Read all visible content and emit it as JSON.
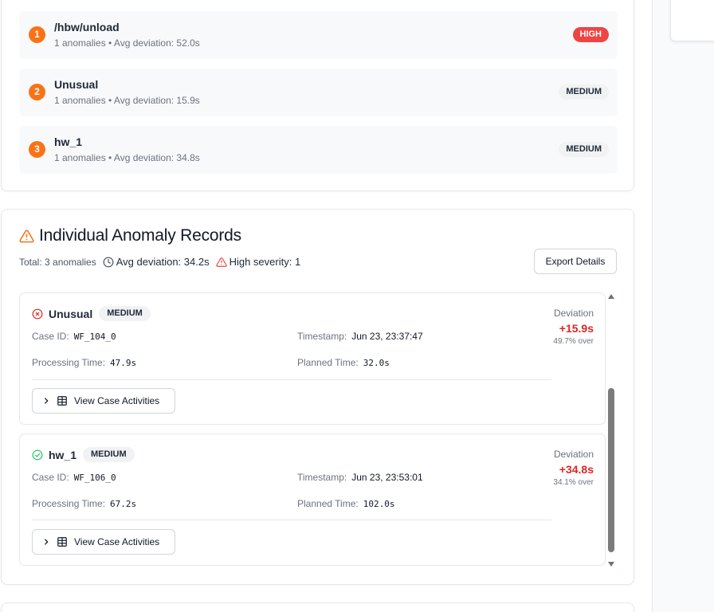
{
  "summary": {
    "items": [
      {
        "rank": "1",
        "title": "/hbw/unload",
        "subtitle": "1 anomalies • Avg deviation: 52.0s",
        "severity": "HIGH"
      },
      {
        "rank": "2",
        "title": "Unusual",
        "subtitle": "1 anomalies • Avg deviation: 15.9s",
        "severity": "MEDIUM"
      },
      {
        "rank": "3",
        "title": "hw_1",
        "subtitle": "1 anomalies • Avg deviation: 34.8s",
        "severity": "MEDIUM"
      }
    ]
  },
  "records": {
    "title": "Individual Anomaly Records",
    "total": "Total: 3 anomalies",
    "avg_deviation": "Avg deviation: 34.2s",
    "high_severity": "High severity: 1",
    "export_label": "Export Details",
    "labels": {
      "case_id": "Case ID:",
      "timestamp": "Timestamp:",
      "processing_time": "Processing Time:",
      "planned_time": "Planned Time:",
      "deviation": "Deviation",
      "view_activities": "View Case Activities"
    },
    "items": [
      {
        "name": "Unusual",
        "severity": "MEDIUM",
        "status_icon": "x-circle-icon",
        "case_id": "WF_104_0",
        "timestamp": "Jun 23, 23:37:47",
        "processing_time": "47.9s",
        "planned_time": "32.0s",
        "deviation": "+15.9s",
        "deviation_pct": "49.7% over"
      },
      {
        "name": "hw_1",
        "severity": "MEDIUM",
        "status_icon": "check-circle-icon",
        "case_id": "WF_106_0",
        "timestamp": "Jun 23, 23:53:01",
        "processing_time": "67.2s",
        "planned_time": "102.0s",
        "deviation": "+34.8s",
        "deviation_pct": "34.1% over"
      }
    ]
  },
  "colors": {
    "accent_orange": "#f97316",
    "high_red": "#ef4444",
    "deviation_red": "#dc2626",
    "success_green": "#22c55e"
  }
}
